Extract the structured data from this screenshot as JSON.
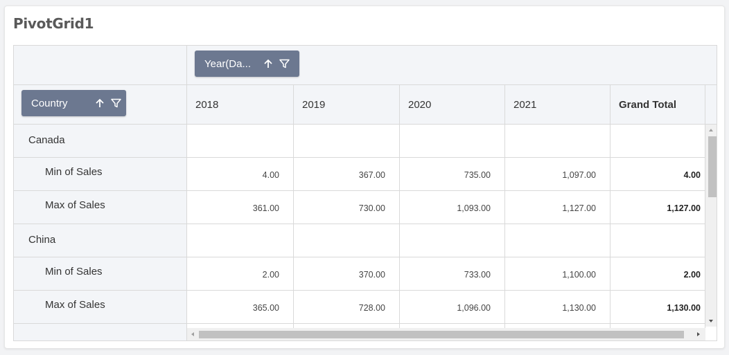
{
  "title": "PivotGrid1",
  "chips": {
    "column_field": "Year(Da...",
    "row_field": "Country"
  },
  "columns": [
    "2018",
    "2019",
    "2020",
    "2021",
    "Grand Total"
  ],
  "rows": [
    {
      "label": "Canada",
      "type": "group",
      "values": [
        "",
        "",
        "",
        "",
        ""
      ]
    },
    {
      "label": "Min of Sales",
      "type": "measure",
      "values": [
        "4.00",
        "367.00",
        "735.00",
        "1,097.00",
        "4.00"
      ]
    },
    {
      "label": "Max of Sales",
      "type": "measure",
      "values": [
        "361.00",
        "730.00",
        "1,093.00",
        "1,127.00",
        "1,127.00"
      ]
    },
    {
      "label": "China",
      "type": "group",
      "values": [
        "",
        "",
        "",
        "",
        ""
      ]
    },
    {
      "label": "Min of Sales",
      "type": "measure",
      "values": [
        "2.00",
        "370.00",
        "733.00",
        "1,100.00",
        "2.00"
      ]
    },
    {
      "label": "Max of Sales",
      "type": "measure",
      "values": [
        "365.00",
        "728.00",
        "1,096.00",
        "1,130.00",
        "1,130.00"
      ]
    }
  ],
  "icons": {
    "sort": "arrow-up-icon",
    "filter": "filter-icon"
  }
}
